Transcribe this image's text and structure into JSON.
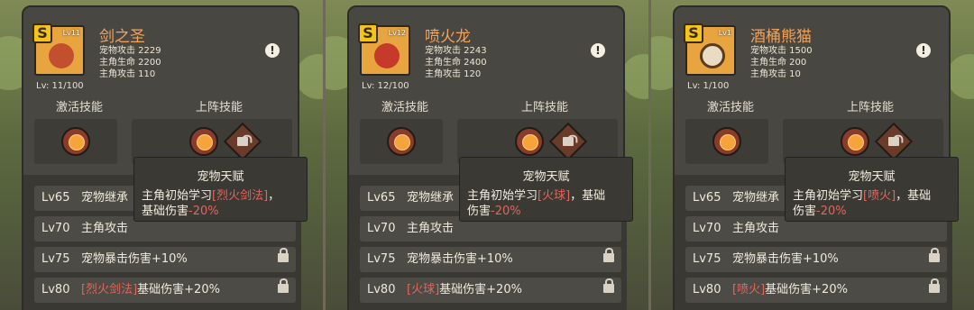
{
  "panels": [
    {
      "pet_name": "剑之圣",
      "rarity_badge": "S",
      "avatar_level": "Lv11",
      "level_progress": "Lv: 11/100",
      "stats": [
        "宠物攻击 2229",
        "主角生命 2200",
        "主角攻击 110"
      ],
      "info_button": "!",
      "active_skill_label": "激活技能",
      "equipped_skill_label": "上阵技能",
      "tooltip": {
        "title": "宠物天赋",
        "line1_prefix": "主角初始学习",
        "line1_skill": "[烈火剑法]",
        "line1_suffix": "，",
        "line2_prefix": "基础伤害",
        "line2_value": "-20%"
      },
      "talents": [
        {
          "level": "Lv65",
          "text": "宠物继承",
          "locked": false
        },
        {
          "level": "Lv70",
          "text": "主角攻击",
          "locked": false
        },
        {
          "level": "Lv75",
          "text": "宠物暴击伤害+10%",
          "locked": true
        },
        {
          "level": "Lv80",
          "skill": "[烈火剑法]",
          "text": "基础伤害+20%",
          "locked": true
        }
      ],
      "avatar_color": "#e8a53f"
    },
    {
      "pet_name": "喷火龙",
      "rarity_badge": "S",
      "avatar_level": "Lv12",
      "level_progress": "Lv: 12/100",
      "stats": [
        "宠物攻击 2243",
        "主角生命 2400",
        "主角攻击 120"
      ],
      "info_button": "!",
      "active_skill_label": "激活技能",
      "equipped_skill_label": "上阵技能",
      "tooltip": {
        "title": "宠物天赋",
        "line1_prefix": "主角初始学习",
        "line1_skill": "[火球]",
        "line1_suffix": "，基础",
        "line2_prefix": "伤害",
        "line2_value": "-20%"
      },
      "talents": [
        {
          "level": "Lv65",
          "text": "宠物继承",
          "locked": false
        },
        {
          "level": "Lv70",
          "text": "主角攻击",
          "locked": false
        },
        {
          "level": "Lv75",
          "text": "宠物暴击伤害+10%",
          "locked": true
        },
        {
          "level": "Lv80",
          "skill": "[火球]",
          "text": "基础伤害+20%",
          "locked": true
        }
      ],
      "avatar_color": "#e8a53f"
    },
    {
      "pet_name": "酒桶熊猫",
      "rarity_badge": "S",
      "avatar_level": "Lv1",
      "level_progress": "Lv: 1/100",
      "stats": [
        "宠物攻击 1500",
        "主角生命 200",
        "主角攻击 10"
      ],
      "info_button": "!",
      "active_skill_label": "激活技能",
      "equipped_skill_label": "上阵技能",
      "tooltip": {
        "title": "宠物天赋",
        "line1_prefix": "主角初始学习",
        "line1_skill": "[喷火]",
        "line1_suffix": "，基础",
        "line2_prefix": "伤害",
        "line2_value": "-20%"
      },
      "talents": [
        {
          "level": "Lv65",
          "text": "宠物继承",
          "locked": false
        },
        {
          "level": "Lv70",
          "text": "主角攻击",
          "locked": false
        },
        {
          "level": "Lv75",
          "text": "宠物暴击伤害+10%",
          "locked": true
        },
        {
          "level": "Lv80",
          "skill": "[喷火]",
          "text": "基础伤害+20%",
          "locked": true
        }
      ],
      "avatar_color": "#e8a53f"
    }
  ]
}
